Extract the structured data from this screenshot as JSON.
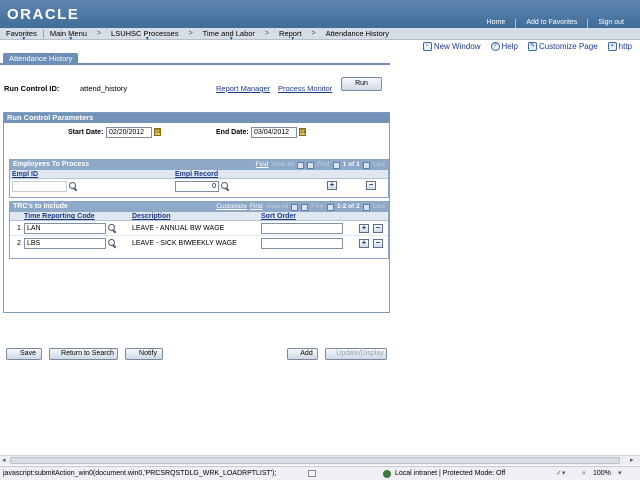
{
  "banner": {
    "logo": "ORACLE",
    "links": [
      "Home",
      "Add to Favorites",
      "Sign out"
    ]
  },
  "menu": {
    "items": [
      "Favorites",
      "Main Menu",
      "LSUHSC Processes",
      "Time and Labor",
      "Report",
      "Attendance History"
    ]
  },
  "toolbar": {
    "new_window": "New Window",
    "help": "Help",
    "customize": "Customize Page",
    "http": "http"
  },
  "tab": {
    "label": "Attendance History"
  },
  "run_control": {
    "label": "Run Control ID:",
    "value": "attend_history",
    "report_manager": "Report Manager",
    "process_monitor": "Process Monitor",
    "run_button": "Run"
  },
  "params": {
    "title": "Run Control Parameters",
    "start_label": "Start Date:",
    "start_value": "02/20/2012",
    "end_label": "End Date:",
    "end_value": "03/04/2012"
  },
  "employees": {
    "title": "Employees To Process",
    "nav": {
      "find": "Find",
      "viewall": "View All",
      "first": "First",
      "count": "1 of 1",
      "last": "Last"
    },
    "col_emplid": "Empl ID",
    "col_emplrcd": "Empl Record",
    "emplid_value": "",
    "emplrcd_value": "0"
  },
  "trcs": {
    "title": "TRC's to Include",
    "nav": {
      "customize": "Customize",
      "find": "Find",
      "viewall": "View All",
      "first": "First",
      "count": "1-2 of 2",
      "last": "Last"
    },
    "col_trc": "Time Reporting Code",
    "col_desc": "Description",
    "col_sort": "Sort Order",
    "rows": [
      {
        "num": "1",
        "code": "LAN",
        "desc": "LEAVE - ANNUAL BW  WAGE",
        "sort": ""
      },
      {
        "num": "2",
        "code": "LBS",
        "desc": "LEAVE - SICK BIWEEKLY WAGE",
        "sort": ""
      }
    ]
  },
  "footer": {
    "save": "Save",
    "return": "Return to Search",
    "notify": "Notify",
    "add": "Add",
    "update": "Update/Display"
  },
  "status": {
    "text": "javascript:submitAction_win0(document.win0,'PRCSRQSTDLG_WRK_LOADRPTLIST');",
    "zone": "Local intranet | Protected Mode: Off",
    "zoom": "100%"
  }
}
